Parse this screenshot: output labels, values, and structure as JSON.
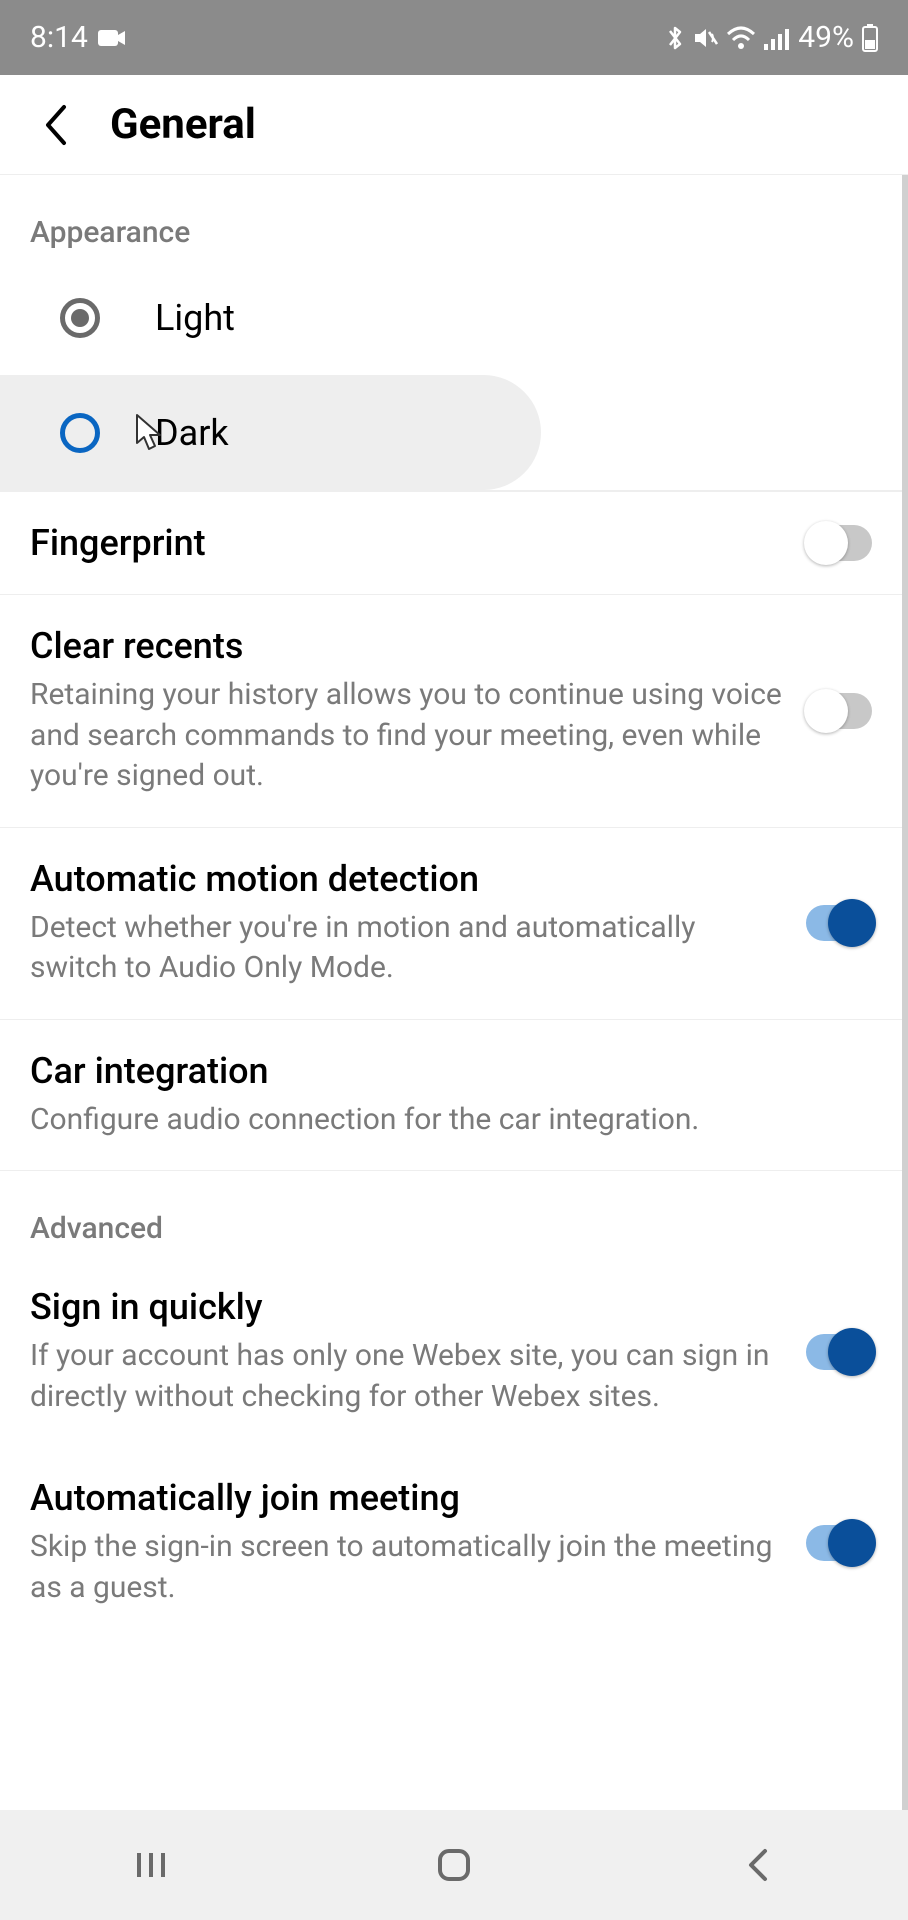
{
  "statusbar": {
    "time": "8:14",
    "battery": "49%"
  },
  "header": {
    "title": "General"
  },
  "sections": {
    "appearance": {
      "label": "Appearance",
      "light": "Light",
      "dark": "Dark"
    },
    "fingerprint": {
      "title": "Fingerprint"
    },
    "clear_recents": {
      "title": "Clear recents",
      "desc": "Retaining your history allows you to continue using voice and search commands to find your meeting, even while you're signed out."
    },
    "motion": {
      "title": "Automatic motion detection",
      "desc": "Detect whether you're in motion and automatically switch to Audio Only Mode."
    },
    "car": {
      "title": "Car integration",
      "desc": "Configure audio connection for the car integration."
    },
    "advanced": {
      "label": "Advanced"
    },
    "signin": {
      "title": "Sign in quickly",
      "desc": "If your account has only one Webex site, you can sign in directly without checking for other Webex sites."
    },
    "autojoin": {
      "title": "Automatically join meeting",
      "desc": "Skip the sign-in screen to automatically join the meeting as a guest."
    }
  }
}
